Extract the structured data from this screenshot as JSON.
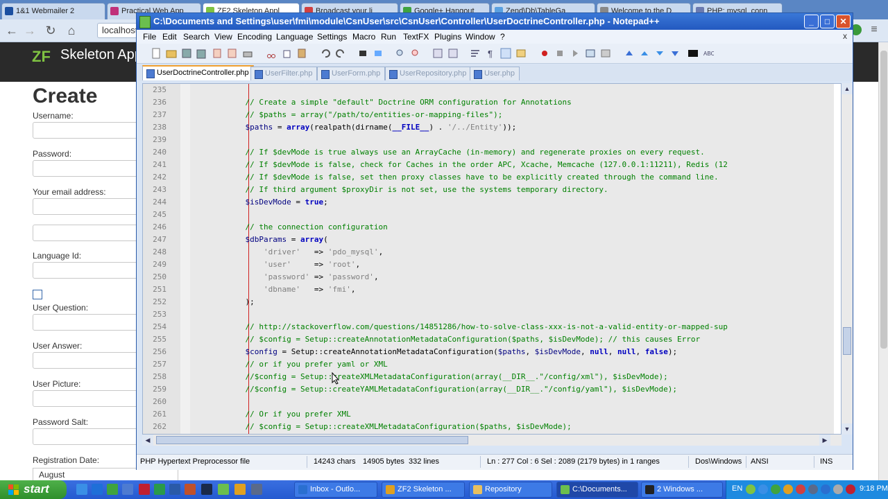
{
  "browser": {
    "tabs": [
      {
        "label": "1&1 Webmailer 2",
        "color": "#1b4fa0"
      },
      {
        "label": "Practical Web App",
        "color": "#c0307a"
      },
      {
        "label": "ZF2 Skeleton Appl",
        "color": "#7fc242"
      },
      {
        "label": "Broadcast your li",
        "color": "#d04040"
      },
      {
        "label": "Google+ Hangout",
        "color": "#3fa33f"
      },
      {
        "label": "Zend\\Db\\TableGa",
        "color": "#5aa0e0"
      },
      {
        "label": "Welcome to the D",
        "color": "#888888"
      },
      {
        "label": "PHP: mysql_conn",
        "color": "#6a7ab0"
      }
    ],
    "url": "localhost",
    "brand": "ZF",
    "app_title": "Skeleton App"
  },
  "form": {
    "heading": "Create",
    "labels": {
      "username": "Username:",
      "password": "Password:",
      "email": "Your email address:",
      "language": "Language Id:",
      "question": "User Question:",
      "answer": "User Answer:",
      "picture": "User Picture:",
      "salt": "Password Salt:",
      "regdate": "Registration Date:"
    },
    "month_value": "August"
  },
  "npp": {
    "title": "C:\\Documents and Settings\\user\\fmi\\module\\CsnUser\\src\\CsnUser\\Controller\\UserDoctrineController.php - Notepad++",
    "win_buttons": {
      "minimize": "_",
      "maximize": "□",
      "close": "✕"
    },
    "menu": [
      "File",
      "Edit",
      "Search",
      "View",
      "Encoding",
      "Language",
      "Settings",
      "Macro",
      "Run",
      "TextFX",
      "Plugins",
      "Window",
      "?"
    ],
    "menu_close": "x",
    "tabs": [
      "UserDoctrineController.php",
      "UserFilter.php",
      "UserForm.php",
      "UserRepository.php",
      "User.php"
    ],
    "active_tab": 0,
    "line_numbers": [
      "235",
      "236",
      "237",
      "238",
      "239",
      "240",
      "241",
      "242",
      "243",
      "244",
      "245",
      "246",
      "247",
      "248",
      "249",
      "250",
      "251",
      "252",
      "253",
      "254",
      "255",
      "256",
      "257",
      "258",
      "259",
      "260",
      "261",
      "262"
    ],
    "code": [
      [],
      [
        [
          "            ",
          ""
        ],
        [
          "// Create a simple \"default\" Doctrine ORM configuration for Annotations",
          "cmt"
        ]
      ],
      [
        [
          "            ",
          ""
        ],
        [
          "// $paths = array(\"/path/to/entities-or-mapping-files\");",
          "cmt"
        ]
      ],
      [
        [
          "            ",
          ""
        ],
        [
          "$paths",
          "var"
        ],
        [
          " = ",
          ""
        ],
        [
          "array",
          "kw"
        ],
        [
          "(realpath(dirname(",
          ""
        ],
        [
          "__FILE__",
          "kw"
        ],
        [
          ") . ",
          ""
        ],
        [
          "'/../Entity'",
          "str"
        ],
        [
          "));",
          ""
        ]
      ],
      [],
      [
        [
          "            ",
          ""
        ],
        [
          "// If $devMode is true always use an ArrayCache (in-memory) and regenerate proxies on every request.",
          "cmt"
        ]
      ],
      [
        [
          "            ",
          ""
        ],
        [
          "// If $devMode is false, check for Caches in the order APC, Xcache, Memcache (127.0.0.1:11211), Redis (12",
          "cmt"
        ]
      ],
      [
        [
          "            ",
          ""
        ],
        [
          "// If $devMode is false, set then proxy classes have to be explicitly created through the command line.",
          "cmt"
        ]
      ],
      [
        [
          "            ",
          ""
        ],
        [
          "// If third argument $proxyDir is not set, use the systems temporary directory.",
          "cmt"
        ]
      ],
      [
        [
          "            ",
          ""
        ],
        [
          "$isDevMode",
          "var"
        ],
        [
          " = ",
          ""
        ],
        [
          "true",
          "kw"
        ],
        [
          ";",
          ""
        ]
      ],
      [],
      [
        [
          "            ",
          ""
        ],
        [
          "// the connection configuration",
          "cmt"
        ]
      ],
      [
        [
          "            ",
          ""
        ],
        [
          "$dbParams",
          "var"
        ],
        [
          " = ",
          ""
        ],
        [
          "array",
          "kw"
        ],
        [
          "(",
          ""
        ]
      ],
      [
        [
          "                ",
          ""
        ],
        [
          "'driver'",
          "str"
        ],
        [
          "   => ",
          ""
        ],
        [
          "'pdo_mysql'",
          "str"
        ],
        [
          ",",
          ""
        ]
      ],
      [
        [
          "                ",
          ""
        ],
        [
          "'user'",
          "str"
        ],
        [
          "     => ",
          ""
        ],
        [
          "'root'",
          "str"
        ],
        [
          ",",
          ""
        ]
      ],
      [
        [
          "                ",
          ""
        ],
        [
          "'password'",
          "str"
        ],
        [
          " => ",
          ""
        ],
        [
          "'password'",
          "str"
        ],
        [
          ",",
          ""
        ]
      ],
      [
        [
          "                ",
          ""
        ],
        [
          "'dbname'",
          "str"
        ],
        [
          "   => ",
          ""
        ],
        [
          "'fmi'",
          "str"
        ],
        [
          ",",
          ""
        ]
      ],
      [
        [
          "            ",
          ""
        ],
        [
          ");",
          ""
        ]
      ],
      [],
      [
        [
          "            ",
          ""
        ],
        [
          "// http://stackoverflow.com/questions/14851286/how-to-solve-class-xxx-is-not-a-valid-entity-or-mapped-sup",
          "cmt"
        ]
      ],
      [
        [
          "            ",
          ""
        ],
        [
          "// $config = Setup::createAnnotationMetadataConfiguration($paths, $isDevMode); // this causes Error",
          "cmt"
        ]
      ],
      [
        [
          "            ",
          ""
        ],
        [
          "$config",
          "var"
        ],
        [
          " = Setup::createAnnotationMetadataConfiguration(",
          ""
        ],
        [
          "$paths",
          "var"
        ],
        [
          ", ",
          ""
        ],
        [
          "$isDevMode",
          "var"
        ],
        [
          ", ",
          ""
        ],
        [
          "null",
          "kw"
        ],
        [
          ", ",
          ""
        ],
        [
          "null",
          "kw"
        ],
        [
          ", ",
          ""
        ],
        [
          "false",
          "kw"
        ],
        [
          ");",
          ""
        ]
      ],
      [
        [
          "            ",
          ""
        ],
        [
          "// or if you prefer yaml or XML",
          "cmt"
        ]
      ],
      [
        [
          "            ",
          ""
        ],
        [
          "//$config = Setup::createXMLMetadataConfiguration(array(__DIR__.\"/config/xml\"), $isDevMode);",
          "cmt"
        ]
      ],
      [
        [
          "            ",
          ""
        ],
        [
          "//$config = Setup::createYAMLMetadataConfiguration(array(__DIR__.\"/config/yaml\"), $isDevMode);",
          "cmt"
        ]
      ],
      [],
      [
        [
          "            ",
          ""
        ],
        [
          "// Or if you prefer XML",
          "cmt"
        ]
      ],
      [
        [
          "            ",
          ""
        ],
        [
          "// $config = Setup::createXMLMetadataConfiguration($paths, $isDevMode);",
          "cmt"
        ]
      ]
    ],
    "status": {
      "lang": "PHP Hypertext Preprocessor file",
      "chars": "14243 chars",
      "bytes": "14905 bytes",
      "lines": "332 lines",
      "pos": "Ln : 277    Col : 6    Sel : 2089 (2179 bytes) in 1 ranges",
      "eol": "Dos\\Windows",
      "encoding": "ANSI",
      "mode": "INS"
    }
  },
  "taskbar": {
    "start": "start",
    "tasks": [
      {
        "label": "Inbox - Outlo...",
        "color": "#2a6fd0"
      },
      {
        "label": "ZF2 Skeleton ...",
        "color": "#e0a020"
      },
      {
        "label": "Repository",
        "color": "#e8c060"
      },
      {
        "label": "C:\\Documents...",
        "color": "#6bbf4e"
      },
      {
        "label": "2 Windows ...",
        "color": "#222222"
      }
    ],
    "active_task": 3,
    "lang": "EN",
    "clock": "9:18 PM"
  },
  "colors": {
    "comment": "#008000",
    "variable": "#000080",
    "keyword": "#0000c0",
    "string": "#808080",
    "selection": "#e9e9e9",
    "fold_marker": "#d02020"
  }
}
